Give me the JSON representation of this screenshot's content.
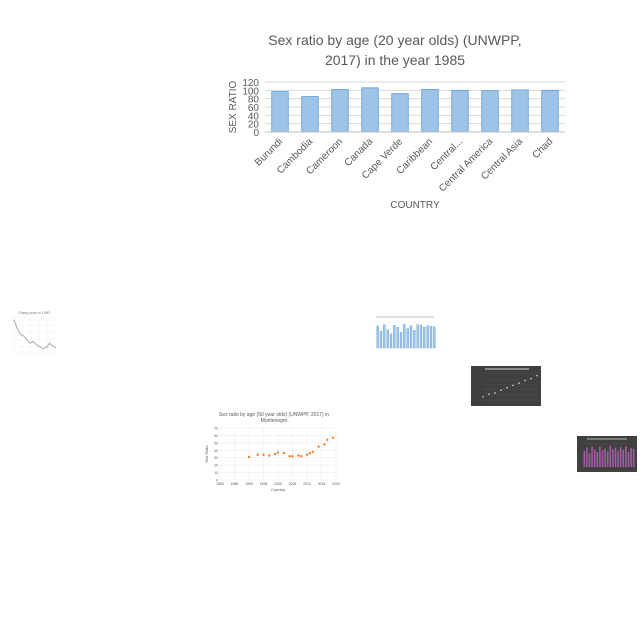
{
  "chart_data": [
    {
      "type": "bar",
      "title": "Sex ratio by age (20 year olds) (UNWPP, 2017) in the year 1985",
      "title_lines": [
        "Sex ratio by age (20 year olds) (UNWPP,",
        "2017) in the year 1985"
      ],
      "xlabel": "COUNTRY",
      "ylabel": "SEX RATIO",
      "categories": [
        "Burundi",
        "Cambodia",
        "Cameroon",
        "Canada",
        "Cape Verde",
        "Caribbean",
        "Central...",
        "Central America",
        "Central Asia",
        "Chad"
      ],
      "values": [
        97,
        85,
        102,
        106,
        92,
        102,
        100,
        99,
        101,
        100
      ],
      "ylim": [
        0,
        120
      ],
      "yticks": [
        0,
        20,
        40,
        60,
        80,
        100,
        120
      ],
      "grid": true,
      "bar_color": "#9dc3e6"
    },
    {
      "type": "line",
      "title": "Sheep price in 1990",
      "values": [
        95,
        70,
        55,
        50,
        40,
        30,
        35,
        25,
        20,
        15,
        18,
        30,
        22,
        18
      ],
      "line_color": "#999999"
    },
    {
      "type": "bar",
      "values": [
        85,
        65,
        90,
        70,
        55,
        88,
        80,
        60,
        92,
        75,
        85,
        68,
        90,
        88,
        80,
        86,
        84,
        82
      ],
      "bar_color": "#9dc3e6"
    },
    {
      "type": "scatter",
      "x": [
        1,
        2,
        3,
        4,
        5,
        6,
        7,
        8,
        9,
        10
      ],
      "y": [
        10,
        18,
        22,
        30,
        38,
        45,
        52,
        60,
        66,
        75
      ],
      "background": "#404040",
      "point_color": "#d9d9d9"
    },
    {
      "type": "scatter",
      "title": "Sex ratio by age (50 year olds) (UNWPP, 2017) in Montenegro",
      "title_lines": [
        "Sex ratio by age (50 year olds) (UNWPP, 2017) in",
        "Montenegro"
      ],
      "xlabel": "Country",
      "ylabel": "Sex Ratio",
      "x": [
        1990,
        1993,
        1995,
        1997,
        1999,
        2000,
        2002,
        2004,
        2005,
        2007,
        2008,
        2010,
        2011,
        2012,
        2014,
        2016,
        2017,
        2019
      ],
      "y": [
        31,
        34,
        34,
        33,
        35,
        37,
        36,
        32,
        32,
        33,
        32,
        34,
        36,
        38,
        45,
        48,
        54,
        57
      ],
      "xlim": [
        1980,
        2020
      ],
      "ylim": [
        0,
        70
      ],
      "xticks": [
        1980,
        1985,
        1990,
        1995,
        2000,
        2005,
        2010,
        2015,
        2020
      ],
      "yticks": [
        0,
        10,
        20,
        30,
        40,
        50,
        60,
        70
      ],
      "point_color": "#ed7d31",
      "grid": true
    },
    {
      "type": "bar",
      "values": [
        70,
        85,
        60,
        90,
        75,
        65,
        88,
        72,
        80,
        68,
        92,
        77,
        84,
        70,
        86,
        74,
        90,
        66,
        82,
        78
      ],
      "background": "#404040",
      "bar_color": "#a55ca5"
    }
  ]
}
